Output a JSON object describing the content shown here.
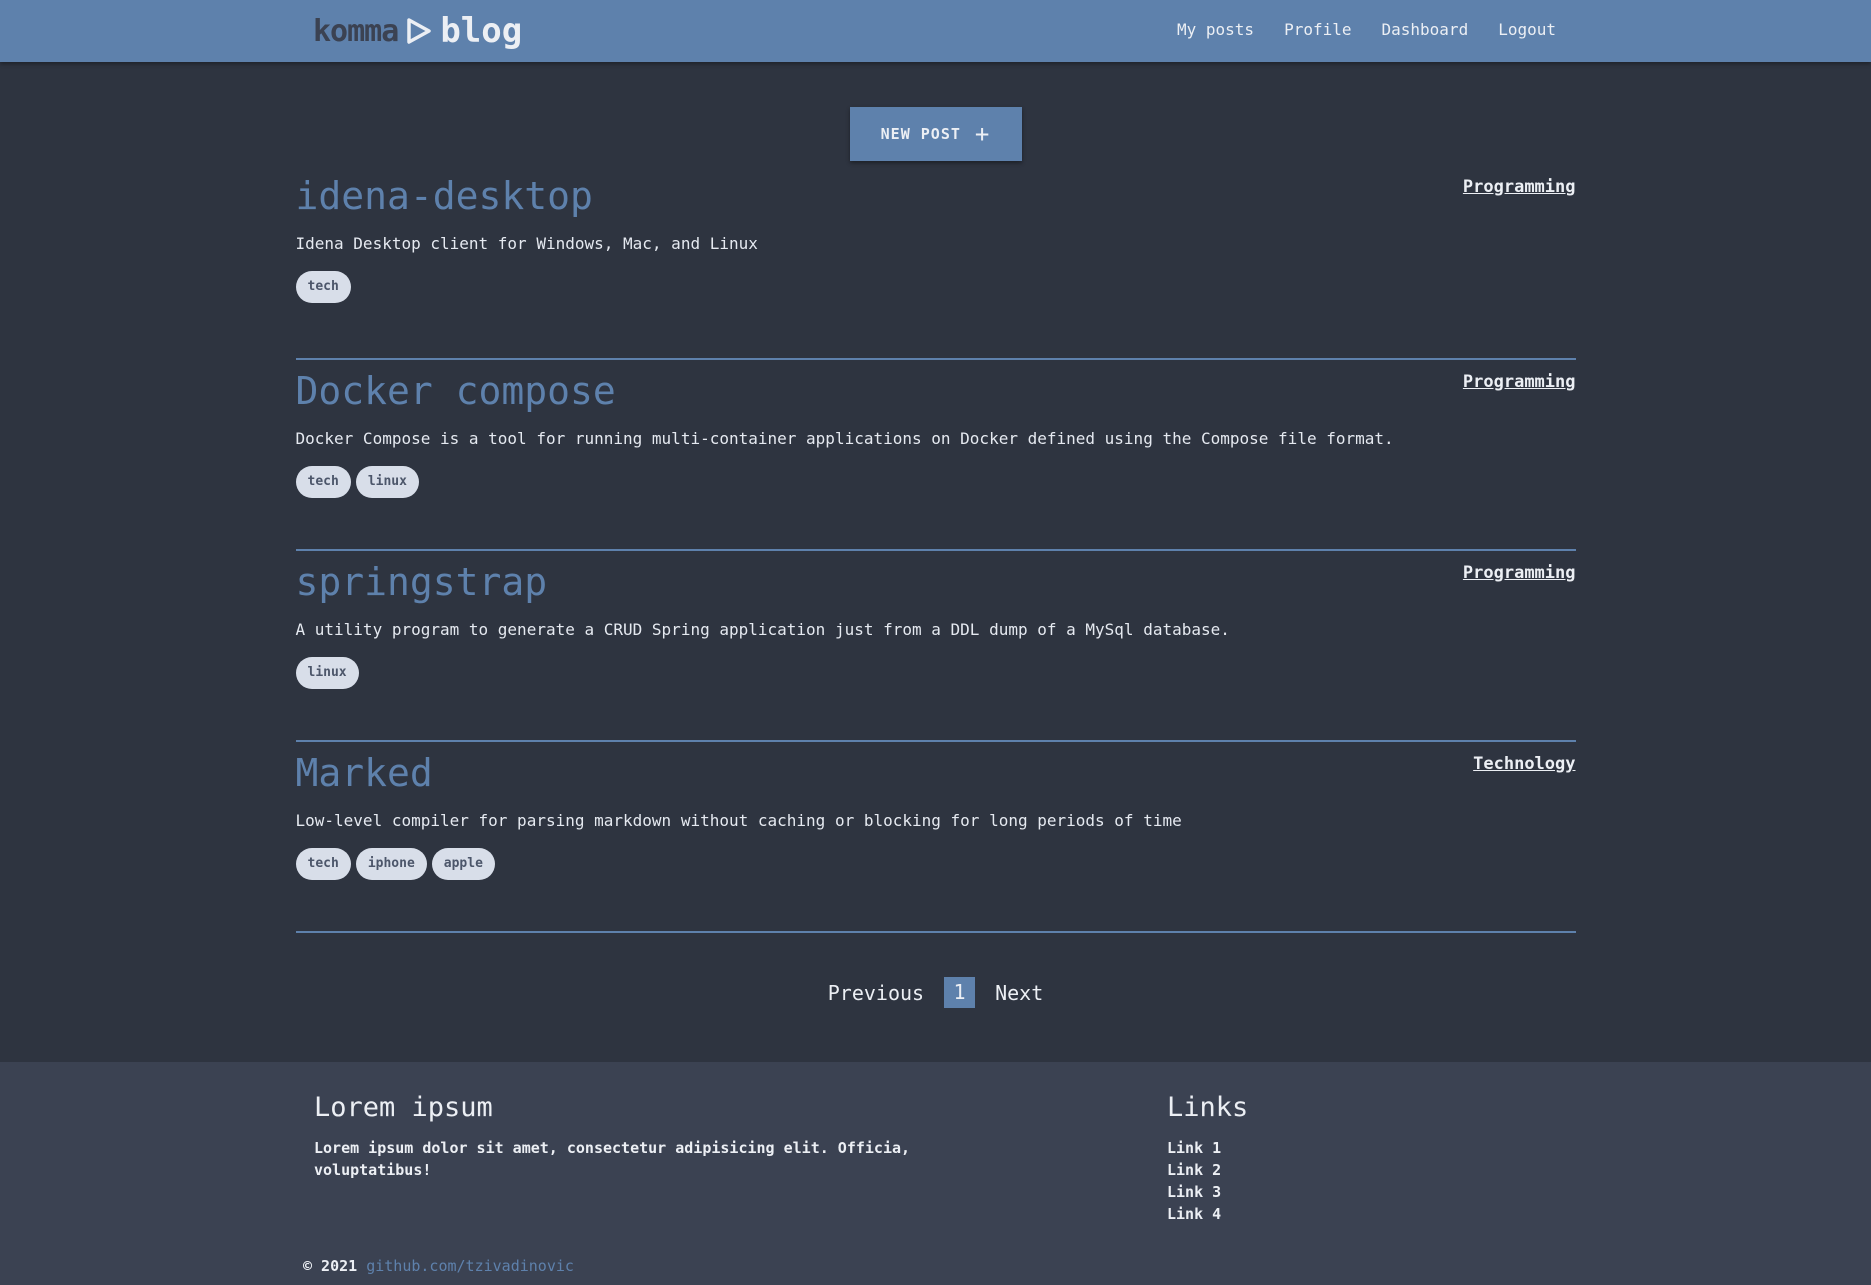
{
  "header": {
    "brand_part1": "komma",
    "brand_part2": "blog",
    "nav": [
      "My posts",
      "Profile",
      "Dashboard",
      "Logout"
    ]
  },
  "new_post_label": "NEW POST",
  "posts": [
    {
      "title": "idena-desktop",
      "category": "Programming",
      "description": "Idena Desktop client for Windows, Mac, and Linux",
      "tags": [
        "tech"
      ]
    },
    {
      "title": "Docker compose",
      "category": "Programming",
      "description": "Docker Compose is a tool for running multi-container applications on Docker defined using the Compose file format.",
      "tags": [
        "tech",
        "linux"
      ]
    },
    {
      "title": "springstrap",
      "category": "Programming",
      "description": "A utility program to generate a CRUD Spring application just from a DDL dump of a MySql database.",
      "tags": [
        "linux"
      ]
    },
    {
      "title": "Marked",
      "category": "Technology",
      "description": "Low-level compiler for parsing markdown without caching or blocking for long periods of time",
      "tags": [
        "tech",
        "iphone",
        "apple"
      ]
    }
  ],
  "pagination": {
    "previous": "Previous",
    "current": "1",
    "next": "Next"
  },
  "footer": {
    "col1_heading": "Lorem ipsum",
    "col1_text": "Lorem ipsum dolor sit amet, consectetur adipisicing elit. Officia, voluptatibus!",
    "col2_heading": "Links",
    "links": [
      "Link 1",
      "Link 2",
      "Link 3",
      "Link 4"
    ],
    "copyright": "© 2021",
    "copyright_link": "github.com/tzivadinovic"
  },
  "colors": {
    "accent": "#5e81ac",
    "background": "#2e3440",
    "footer_bg": "#3b4252",
    "tag_bg": "#d8dee9"
  },
  "icons": {
    "brand": "play-triangle-icon",
    "new_post": "plus-icon"
  }
}
